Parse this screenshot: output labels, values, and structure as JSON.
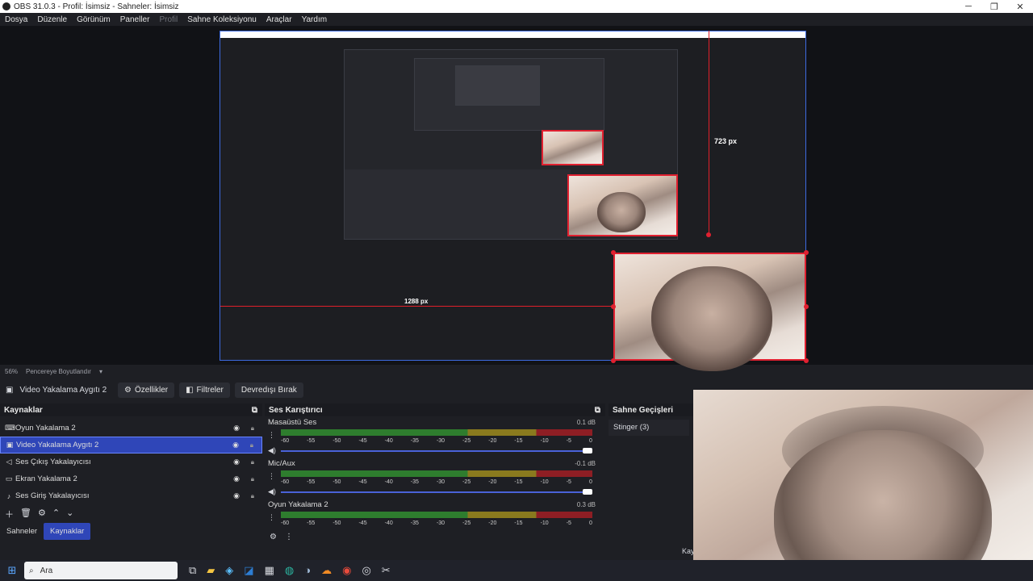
{
  "window": {
    "title": "OBS 31.0.3 - Profil: İsimsiz - Sahneler: İsimsiz",
    "minimize": "─",
    "maximize": "❐",
    "close": "✕"
  },
  "menu": [
    "Dosya",
    "Düzenle",
    "Görünüm",
    "Paneller",
    "Profil",
    "Sahne Koleksiyonu",
    "Araçlar",
    "Yardım"
  ],
  "preview": {
    "measure_h": "1288 px",
    "measure_v": "723 px",
    "zoom": "56%",
    "zoom_mode": "Pencereye Boyutlandır"
  },
  "toolbar": {
    "source_name": "Video Yakalama Aygıtı 2",
    "properties": "Özellikler",
    "filters": "Filtreler",
    "deactivate": "Devredışı Bırak"
  },
  "sources": {
    "title": "Kaynaklar",
    "items": [
      {
        "label": "Oyun Yakalama 2",
        "icon": "gamepad-icon"
      },
      {
        "label": "Video Yakalama Aygıtı 2",
        "icon": "camera-icon",
        "selected": true
      },
      {
        "label": "Ses Çıkış Yakalayıcısı",
        "icon": "speaker-icon"
      },
      {
        "label": "Ekran Yakalama 2",
        "icon": "monitor-icon"
      },
      {
        "label": "Ses Giriş Yakalayıcısı",
        "icon": "mic-icon"
      }
    ]
  },
  "tabs": {
    "scenes": "Sahneler",
    "sources": "Kaynaklar"
  },
  "mixer": {
    "title": "Ses Karıştırıcı",
    "scale": [
      "-60",
      "-55",
      "-50",
      "-45",
      "-40",
      "-35",
      "-30",
      "-25",
      "-20",
      "-15",
      "-10",
      "-5",
      "0"
    ],
    "channels": [
      {
        "name": "Masaüstü Ses",
        "db": "0.1 dB"
      },
      {
        "name": "Mic/Aux",
        "db": "-0.1 dB"
      },
      {
        "name": "Oyun Yakalama 2",
        "db": "0.3 dB"
      }
    ]
  },
  "transitions": {
    "title": "Sahne Geçişleri",
    "item": "Stinger (3)",
    "partial_label": "Kay"
  },
  "taskbar": {
    "search": "Ara"
  }
}
